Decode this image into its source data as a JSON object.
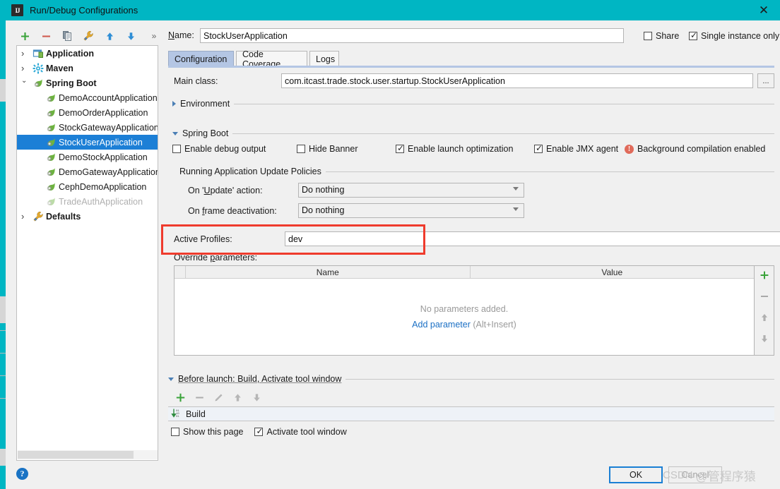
{
  "window": {
    "title": "Run/Debug Configurations",
    "logo_text": "IJ",
    "close_icon": "close-icon"
  },
  "toolbar": {
    "add": "+",
    "remove": "−",
    "copy": "copy-icon",
    "edit_templates": "wrench-icon",
    "move_up": "arrow-up-icon",
    "move_down": "arrow-down-icon",
    "more": "»"
  },
  "tree": {
    "nodes": [
      {
        "label": "Application",
        "level": 0,
        "expanded": false,
        "icon": "application-icon",
        "selected": false,
        "disabled": false
      },
      {
        "label": "Maven",
        "level": 0,
        "expanded": false,
        "icon": "maven-icon",
        "selected": false,
        "disabled": false
      },
      {
        "label": "Spring Boot",
        "level": 0,
        "expanded": true,
        "icon": "spring-boot-icon",
        "selected": false,
        "disabled": false
      },
      {
        "label": "DemoAccountApplication",
        "level": 1,
        "icon": "spring-boot-icon",
        "selected": false,
        "disabled": false
      },
      {
        "label": "DemoOrderApplication",
        "level": 1,
        "icon": "spring-boot-icon",
        "selected": false,
        "disabled": false
      },
      {
        "label": "StockGatewayApplication",
        "level": 1,
        "icon": "spring-boot-icon",
        "selected": false,
        "disabled": false
      },
      {
        "label": "StockUserApplication",
        "level": 1,
        "icon": "spring-boot-icon",
        "selected": true,
        "disabled": false
      },
      {
        "label": "DemoStockApplication",
        "level": 1,
        "icon": "spring-boot-icon",
        "selected": false,
        "disabled": false
      },
      {
        "label": "DemoGatewayApplication",
        "level": 1,
        "icon": "spring-boot-icon",
        "selected": false,
        "disabled": false
      },
      {
        "label": "CephDemoApplication",
        "level": 1,
        "icon": "spring-boot-icon",
        "selected": false,
        "disabled": false
      },
      {
        "label": "TradeAuthApplication",
        "level": 1,
        "icon": "spring-boot-icon",
        "selected": false,
        "disabled": true
      },
      {
        "label": "Defaults",
        "level": 0,
        "expanded": false,
        "icon": "wrench-icon",
        "selected": false,
        "disabled": false
      }
    ]
  },
  "help_button": "?",
  "name_row": {
    "label": "Name:",
    "value": "StockUserApplication",
    "placeholder": "",
    "share_label": "Share",
    "share_checked": false,
    "single_instance_label": "Single instance only",
    "single_instance_checked": true
  },
  "tabs": [
    {
      "label": "Configuration",
      "active": true
    },
    {
      "label": "Code Coverage",
      "active": false
    },
    {
      "label": "Logs",
      "active": false
    }
  ],
  "configuration": {
    "main_class_label": "Main class:",
    "main_class_value": "com.itcast.trade.stock.user.startup.StockUserApplication",
    "main_class_browse": "...",
    "environment_section": "Environment",
    "spring_boot_section": "Spring Boot",
    "checkboxes": [
      {
        "label": "Enable debug output",
        "checked": false
      },
      {
        "label": "Hide Banner",
        "checked": false
      },
      {
        "label": "Enable launch optimization",
        "checked": true
      },
      {
        "label": "Enable JMX agent",
        "checked": true
      }
    ],
    "background_compilation": "Background compilation enabled",
    "background_compilation_icon": "warning-icon",
    "policies_title": "Running Application Update Policies",
    "on_update_label": "On 'Update' action:",
    "on_update_value": "Do nothing",
    "on_frame_label": "On frame deactivation:",
    "on_frame_value": "Do nothing",
    "active_profiles_label": "Active Profiles:",
    "active_profiles_value": "dev",
    "override_parameters_label": "Override parameters:",
    "param_table": {
      "columns": [
        "Name",
        "Value"
      ],
      "rows": [],
      "empty_text": "No parameters added.",
      "add_link": "Add parameter",
      "add_hint": "(Alt+Insert)"
    },
    "param_side_buttons": [
      "add-icon",
      "remove-icon",
      "move-up-icon",
      "move-down-icon"
    ]
  },
  "before_launch": {
    "title": "Before launch: Build, Activate tool window",
    "toolbar": [
      "add-icon",
      "remove-icon",
      "edit-icon",
      "move-up-icon",
      "move-down-icon"
    ],
    "tasks": [
      {
        "label": "Build",
        "icon": "build-icon"
      }
    ],
    "show_this_page_label": "Show this page",
    "show_this_page_checked": false,
    "activate_tool_window_label": "Activate tool window",
    "activate_tool_window_checked": true
  },
  "footer": {
    "ok_label": "OK",
    "cancel_label": "Cancel"
  },
  "watermark": {
    "site": "CSDN",
    "user": "@管程序猿"
  },
  "colors": {
    "titlebar": "#00b6c3",
    "selection": "#1c7fd6",
    "accent_tab": "#b4c6e4",
    "annotation": "#ef3b2d",
    "link": "#1a6fc4"
  }
}
